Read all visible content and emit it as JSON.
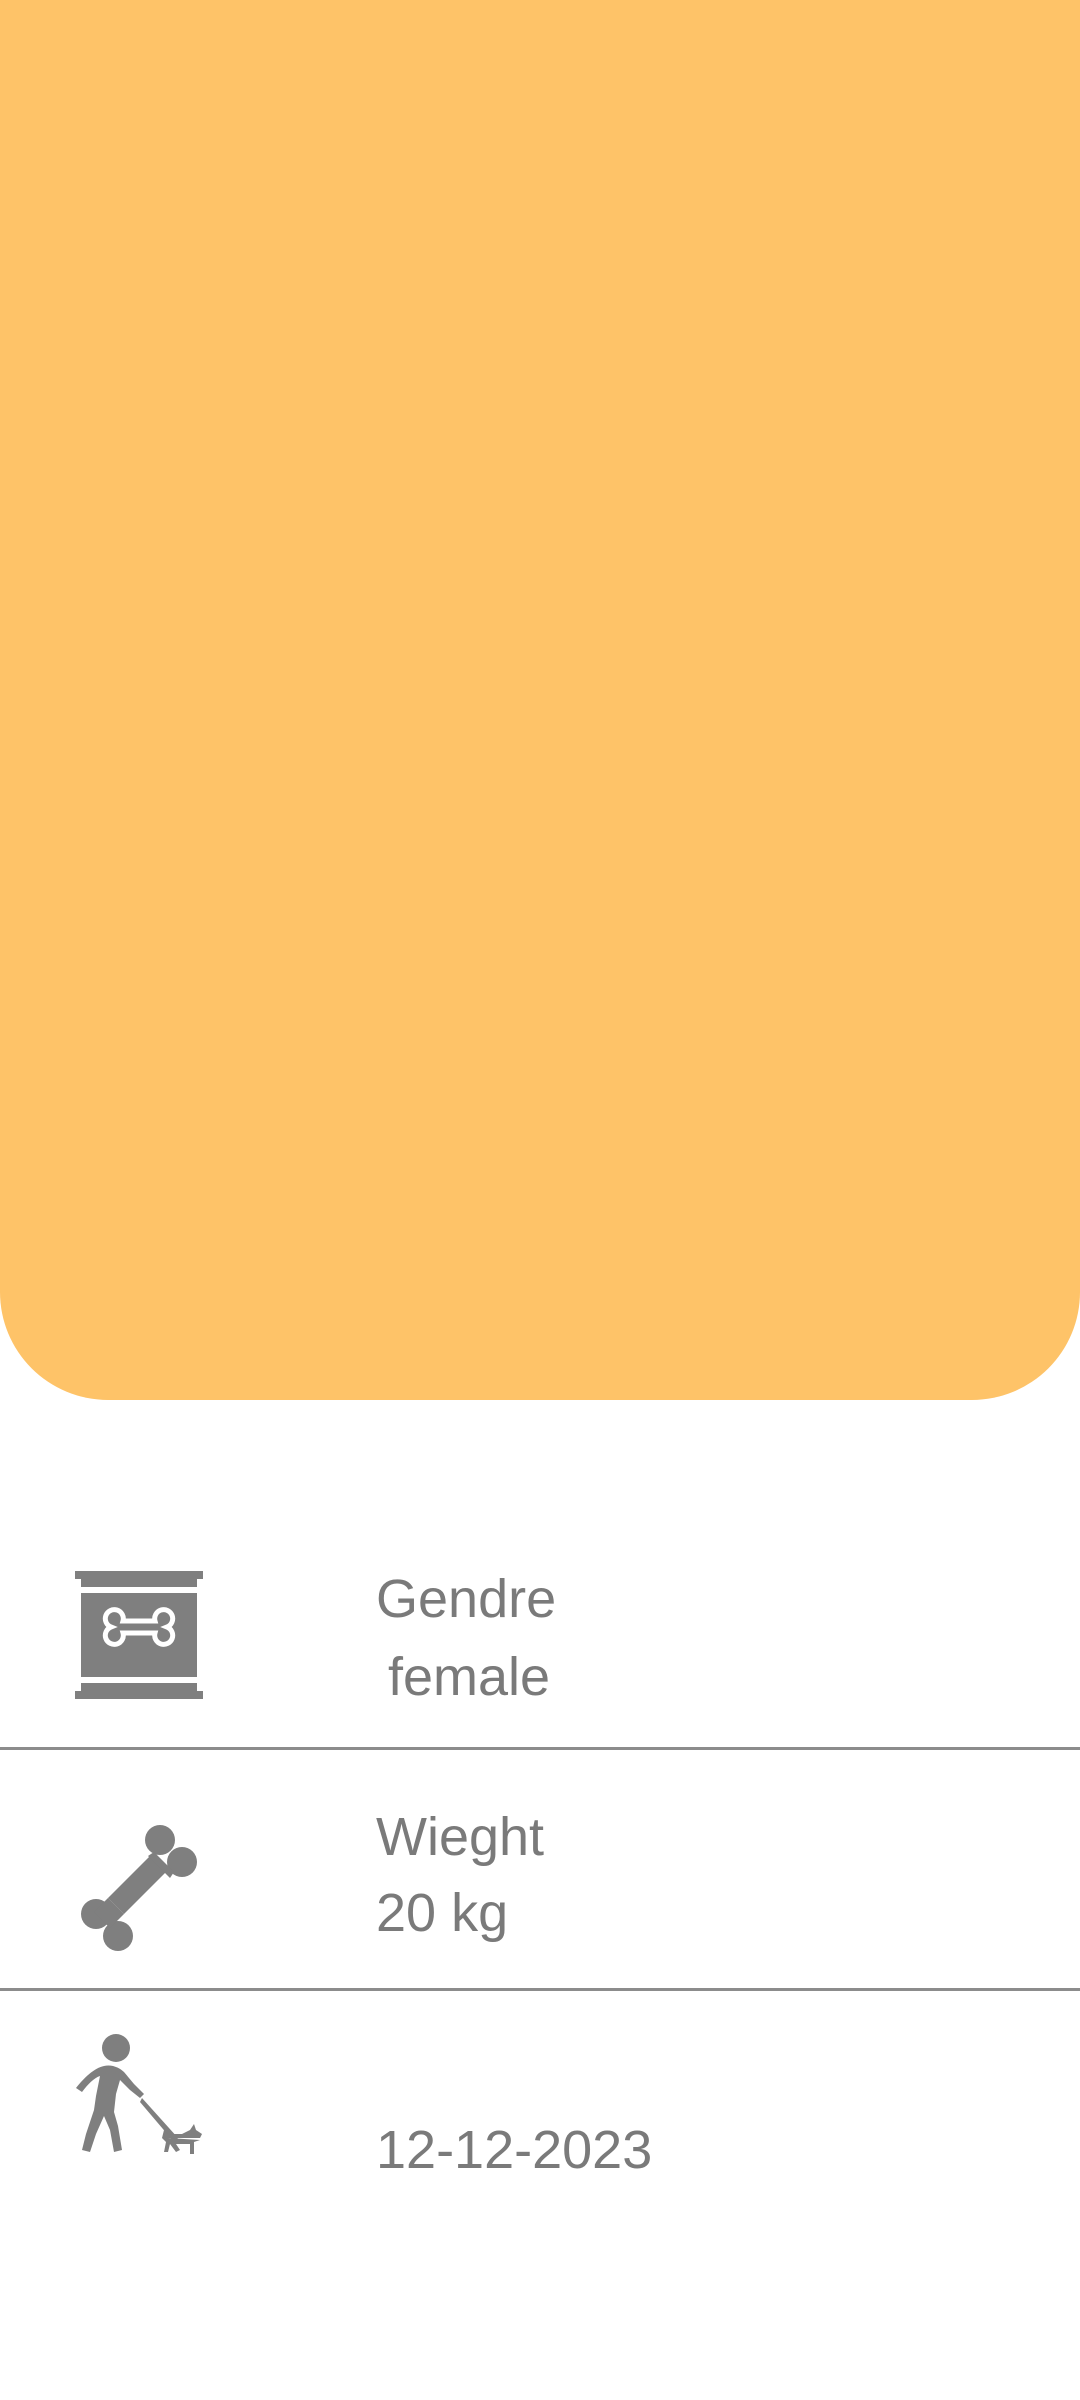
{
  "details": {
    "gender": {
      "icon": "dog-food-can-icon",
      "label": "Gendre",
      "value": "female"
    },
    "weight": {
      "icon": "bone-icon",
      "label": "Wieght",
      "value": "20 kg"
    },
    "date": {
      "icon": "dog-walking-icon",
      "value": "12-12-2023"
    }
  },
  "colors": {
    "hero_background": "#FEC368",
    "text": "#7a7a7a",
    "icon": "#7f7f7f",
    "divider": "#8c8c8c"
  }
}
